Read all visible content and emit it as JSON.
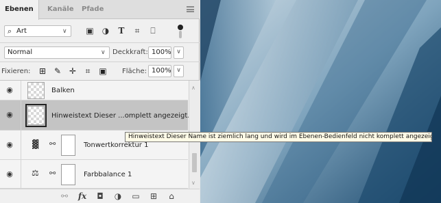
{
  "tabs": [
    {
      "label": "Ebenen",
      "active": true
    },
    {
      "label": "Kanäle",
      "active": false
    },
    {
      "label": "Pfade",
      "active": false
    }
  ],
  "filter": {
    "kind_label": "Art",
    "icons": [
      "image-filter-icon",
      "adjustment-filter-icon",
      "type-filter-icon",
      "shape-filter-icon",
      "smartobject-filter-icon"
    ]
  },
  "blend": {
    "mode": "Normal",
    "opacity_label": "Deckkraft:",
    "opacity_value": "100%"
  },
  "lock": {
    "label": "Fixieren:",
    "fill_label": "Fläche:",
    "fill_value": "100%"
  },
  "layers": [
    {
      "name": "Balken",
      "type": "pixel",
      "selected": false
    },
    {
      "name": "Hinweistext Dieser ...omplett angezeigt.",
      "type": "pixel",
      "selected": true
    },
    {
      "name": "Tonwertkorrektur 1",
      "type": "levels",
      "selected": false
    },
    {
      "name": "Farbbalance 1",
      "type": "color-balance",
      "selected": false
    }
  ],
  "tooltip": "Hinweistext Dieser Name ist ziemlich lang und wird im Ebenen-Bedienfeld nicht komplett angezeigt.",
  "footer_icons": [
    "link-icon",
    "fx-icon",
    "mask-icon",
    "adjustment-icon",
    "group-folder-icon",
    "new-layer-icon",
    "trash-icon"
  ],
  "colors": {
    "panel_bg": "#f0f0f0",
    "selected_layer": "#c4c4c4",
    "tooltip_bg": "#fffbe6",
    "canvas_dark": "#1d4a6e",
    "canvas_light": "#c9d8e2"
  }
}
